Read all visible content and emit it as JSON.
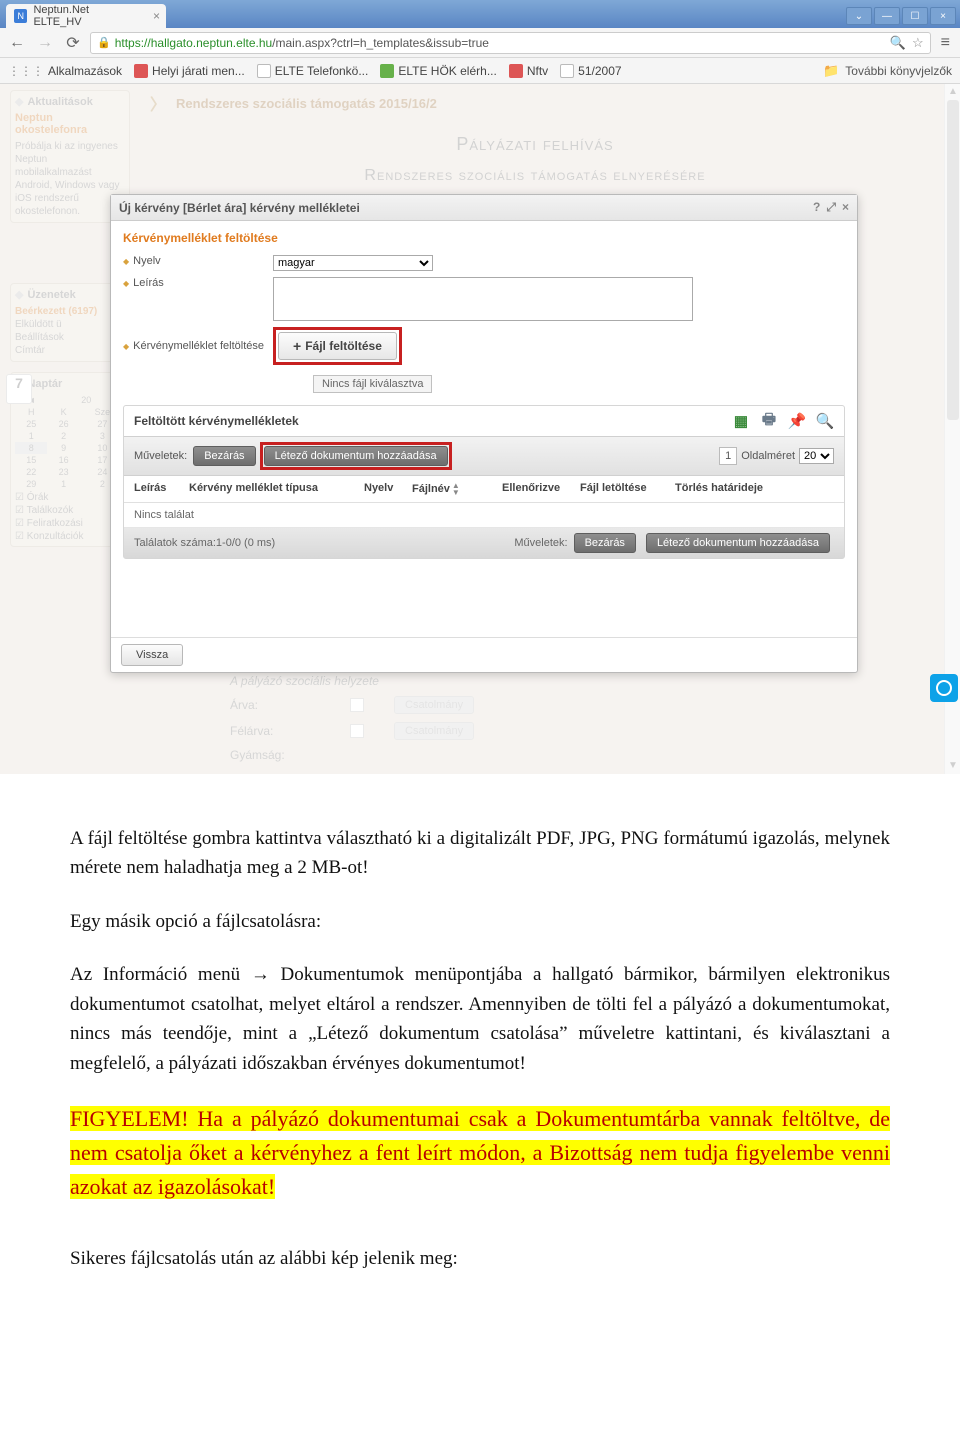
{
  "browser": {
    "tab_title": "Neptun.Net ELTE_HV",
    "url_proto": "https://",
    "url_host": "hallgato.neptun.elte.hu",
    "url_path": "/main.aspx?ctrl=h_templates&issub=true",
    "bookmarks": {
      "apps": "Alkalmazások",
      "b1": "Helyi járati men...",
      "b2": "ELTE Telefonkö...",
      "b3": "ELTE HÖK elérh...",
      "b4": "Nftv",
      "b5": "51/2007",
      "more": "További könyvjelzők"
    }
  },
  "neptun": {
    "left": {
      "box1_title": "Aktualitások",
      "smart_title": "Neptun okostelefonra",
      "smart_text": "Próbálja ki az ingyenes Neptun mobilalkalmazást Android, Windows vagy iOS rendszerű okostelefonon.",
      "msg_title": "Üzenetek",
      "msg1": "Beérkezett (6197)",
      "msg2": "Elküldött ü",
      "msg3": "Beállítások",
      "msg4": "Címtár",
      "cal_title": "Naptár",
      "cal_hdr": [
        "H",
        "K",
        "Sze"
      ],
      "cal_rows": [
        [
          "25",
          "26",
          "27"
        ],
        [
          "1",
          "2",
          "3"
        ],
        [
          "8",
          "9",
          "10"
        ],
        [
          "15",
          "16",
          "17"
        ],
        [
          "22",
          "23",
          "24"
        ],
        [
          "29",
          "1",
          "2"
        ]
      ],
      "chk1": "Órák",
      "chk2": "Találkozók",
      "chk3": "Feliratkozási",
      "chk4": "Konzultációk",
      "date_badge": "7"
    },
    "breadcrumb": "Rendszeres szociális támogatás 2015/16/2",
    "title1": "Pályázati felhívás",
    "title2": "Rendszeres szociális támogatás elnyerésére",
    "lower": {
      "heading": "A pályázó szociális helyzete",
      "r1": "Árva:",
      "r2": "Félárva:",
      "r3": "Gyámság:",
      "btn": "Csatolmány"
    }
  },
  "modal": {
    "title": "Új kérvény [Bérlet ára] kérvény mellékletei",
    "section": "Kérvénymelléklet feltöltése",
    "lbl_lang": "Nyelv",
    "lang_value": "magyar",
    "lbl_desc": "Leírás",
    "lbl_upload": "Kérvénymelléklet feltöltése",
    "upload_btn": "Fájl feltöltése",
    "no_file": "Nincs fájl kiválasztva",
    "panel_title": "Feltöltött kérvénymellékletek",
    "ops_label": "Műveletek:",
    "btn_close": "Bezárás",
    "btn_existing": "Létező dokumentum hozzáadása",
    "page_label": "Oldalméret",
    "page_cur": "1",
    "page_size": "20",
    "cols": {
      "leiras": "Leírás",
      "tipus": "Kérvény melléklet típusa",
      "nyelv": "Nyelv",
      "fajlnev": "Fájlnév",
      "ellen": "Ellenőrizve",
      "letolt": "Fájl letöltése",
      "torles": "Törlés határideje"
    },
    "no_result": "Nincs találat",
    "footer_count": "Találatok száma:1-0/0 (0 ms)",
    "back": "Vissza"
  },
  "doc": {
    "p1": "A fájl feltöltése gombra kattintva választható ki a digitalizált PDF, JPG, PNG formátumú igazolás, melynek mérete nem haladhatja meg a 2 MB-ot!",
    "p2a": "Egy másik opció a fájlcsatolásra:",
    "p2b": "Az Információ menü ",
    "p2arrow": "→",
    "p2c": " Dokumentumok menüpontjába a hallgató bármikor, bármilyen elektronikus dokumentumot csatolhat, melyet eltárol a rendszer. Amennyiben de tölti fel a pályázó a dokumentumokat, nincs más teendője, mint a „Létező dokumentum csatolása” műveletre kattintani, és kiválasztani a megfelelő, a pályázati időszakban érvényes dokumentumot!",
    "warn1": "FIGYELEM!",
    "warn2": " Ha a pályázó dokumentumai csak a Dokumentumtárba vannak feltöltve, de nem csatolja őket a kérvényhez a fent leírt módon, a Bizottság nem tudja figyelembe venni azokat az igazolásokat!",
    "p3": "Sikeres fájlcsatolás után az alábbi kép jelenik meg:"
  }
}
